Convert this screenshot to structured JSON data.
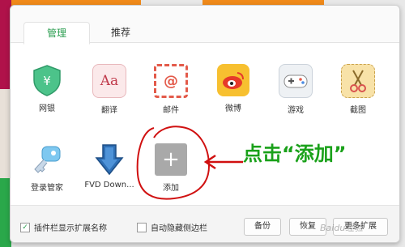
{
  "tabs": [
    {
      "label": "管理"
    },
    {
      "label": "推荐"
    }
  ],
  "extensions": [
    {
      "label": "网银",
      "icon": "shield-yen-icon"
    },
    {
      "label": "翻译",
      "icon": "translate-aa-icon"
    },
    {
      "label": "邮件",
      "icon": "mail-at-icon"
    },
    {
      "label": "微博",
      "icon": "weibo-icon"
    },
    {
      "label": "游戏",
      "icon": "gamepad-icon"
    },
    {
      "label": "截图",
      "icon": "scissors-icon"
    },
    {
      "label": "登录管家",
      "icon": "key-icon"
    },
    {
      "label": "FVD Down...",
      "icon": "download-arrow-icon"
    },
    {
      "label": "添加",
      "icon": "plus-icon"
    }
  ],
  "annotation": "点击“添加”",
  "footer": {
    "show_names_label": "插件栏显示扩展名称",
    "show_names_checked": true,
    "auto_hide_label": "自动隐藏侧边栏",
    "auto_hide_checked": false,
    "backup_label": "备份",
    "restore_label": "恢复",
    "more_label": "更多扩展"
  },
  "watermark": "Baidu经验",
  "colors": {
    "accent": "#2a9d4f",
    "annotation": "#1aa11a",
    "circle": "#d01010"
  }
}
